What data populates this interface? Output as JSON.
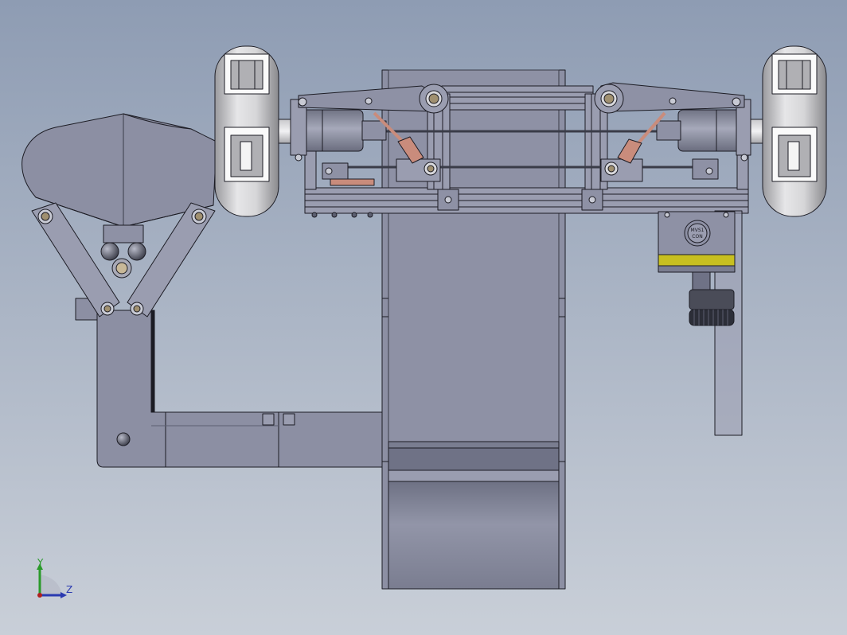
{
  "viewport": {
    "background_top": "#8e9cb3",
    "background_bottom": "#c9cfd8"
  },
  "colors": {
    "part_fill": "#8c8fa3",
    "part_fill_light": "#9a9db0",
    "part_fill_dark": "#6f7286",
    "edge": "#1c1c24",
    "wheel_light": "#e4e4e6",
    "wheel_dark": "#8a8a8e",
    "rod_color": "#c98c7c",
    "camera_yellow": "#c8c020",
    "axis_y_color": "#2a9a2a",
    "axis_z_color": "#2a3ab0",
    "axis_origin_color": "#b02020"
  },
  "components": [
    "left-omni-wheel",
    "right-omni-wheel",
    "aluminum-profile-frame",
    "linkage-arm-left",
    "linkage-arm-right",
    "shock-absorber-left",
    "shock-absorber-right",
    "drive-motor-left",
    "drive-motor-right",
    "central-track-belt",
    "gripper-hopper",
    "gripper-linkage",
    "support-arm",
    "industrial-camera",
    "mounting-bracket"
  ],
  "camera": {
    "label_line1": "MVS1",
    "label_line2": "CON"
  },
  "triad": {
    "y_label": "Y",
    "z_label": "Z"
  }
}
